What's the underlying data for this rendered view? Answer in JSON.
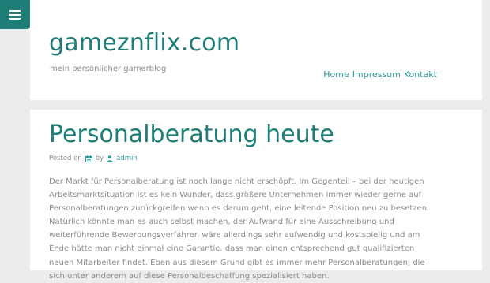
{
  "menu": {
    "icon": "hamburger-menu-icon",
    "color": "#1f7d78"
  },
  "header": {
    "title": "gameznflix.com",
    "description": "mein persönlicher gamerblog",
    "nav": [
      {
        "label": "Home"
      },
      {
        "label": "Impressum"
      },
      {
        "label": "Kontakt"
      }
    ]
  },
  "post": {
    "title": "Personalberatung heute",
    "meta": {
      "posted_on": "Posted on",
      "date_icon": "calendar-icon",
      "by": "by",
      "author_icon": "user-icon",
      "author": "admin"
    },
    "lines": [
      "Der Markt für Personalberatung ist noch lange nicht erschöpft. Im Gegenteil – bei der heutigen",
      "Arbeitsmarktsituation ist es kein Wunder, dass größere Unternehmen immer wieder gerne auf",
      "Personalberatungen zurückgreifen wenn es darum geht, eine leitende Position neu zu besetzen.",
      "Natürlich könnte man es auch selbst machen, der Aufwand für eine Ausschreibung und",
      "weiterführende Bewerbungsverfahren wäre allerdings sehr aufwendig und kostspielig und am",
      "Ende hätte man nicht einmal eine Garantie, dass man einen entsprechend gut qualifizierten",
      "neuen Mitarbeiter findet. Eben aus diesem Grund gibt es immer mehr Personalberatungen, die",
      "sich unter anderem auf diese Personalbeschaffung spezialisiert haben."
    ]
  },
  "colors": {
    "accent": "#1f7d78",
    "link": "#2a9c95",
    "background": "#ececec"
  }
}
